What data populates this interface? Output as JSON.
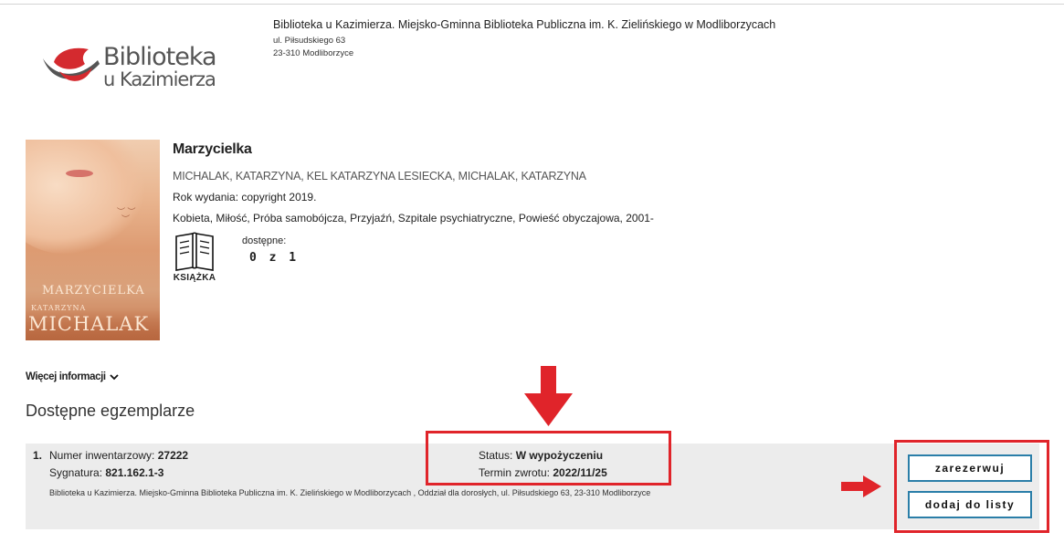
{
  "library": {
    "logo_line1": "Biblioteka",
    "logo_line2": "u Kazimierza",
    "name": "Biblioteka u Kazimierza. Miejsko-Gminna Biblioteka Publiczna im. K. Zielińskiego w Modliborzycach",
    "street": "ul. Piłsudskiego 63",
    "city": "23-310 Modliborzyce"
  },
  "book": {
    "title": "Marzycielka",
    "authors": "MICHALAK, KATARZYNA, KEL KATARZYNA LESIECKA, MICHALAK, KATARZYNA",
    "year": "Rok wydania: copyright 2019.",
    "subjects": "Kobieta, Miłość, Próba samobójcza, Przyjaźń, Szpitale psychiatryczne, Powieść obyczajowa, 2001-",
    "cover": {
      "title": "MARZYCIELKA",
      "author_first": "KATARZYNA",
      "author_last": "MICHALAK"
    },
    "type_icon": "open-book-icon",
    "type_label": "KSIĄŻKA",
    "availability_label": "dostępne:",
    "availability_value": "0 z 1"
  },
  "more_info": {
    "label": "Więcej informacji",
    "icon": "chevron-down-icon"
  },
  "copies": {
    "heading": "Dostępne egzemplarze",
    "items": [
      {
        "number": "1.",
        "inventory_label": "Numer inwentarzowy: ",
        "inventory_value": "27222",
        "signature_label": "Sygnatura: ",
        "signature_value": "821.162.1-3",
        "location": "Biblioteka u Kazimierza. Miejsko-Gminna Biblioteka Publiczna im. K. Zielińskiego w Modliborzycach , Oddział dla dorosłych, ul. Piłsudskiego 63, 23-310 Modliborzyce",
        "status_label": "Status: ",
        "status_value": "W wypożyczeniu",
        "due_label": "Termin zwrotu: ",
        "due_value": "2022/11/25",
        "reserve_label": "zarezerwuj",
        "add_to_list_label": "dodaj do listy"
      }
    ]
  },
  "colors": {
    "annotation_red": "#e0242a",
    "button_border": "#2a7ea8",
    "row_background": "#ececec"
  }
}
